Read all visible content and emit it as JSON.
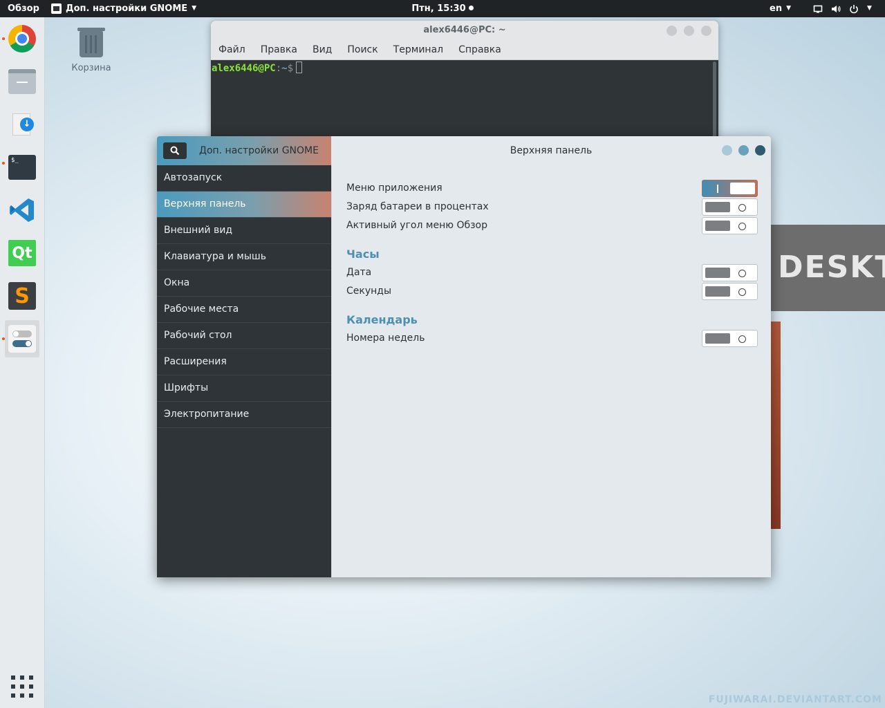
{
  "topbar": {
    "overview": "Обзор",
    "app_menu": "Доп. настройки GNOME",
    "clock": "Птн, 15:30",
    "lang": "en"
  },
  "desktop": {
    "trash_label": "Корзина",
    "wallpaper_text": "DESKT",
    "watermark": "FUJIWARAI.DEVIANTART.COM"
  },
  "dock": {
    "apps": [
      "chrome-icon",
      "files-icon",
      "downloader-icon",
      "terminal-icon",
      "vscode-icon",
      "qt-creator-icon",
      "sublime-text-icon",
      "gnome-tweaks-icon"
    ],
    "qt_label": "Qt",
    "sublime_label": "S",
    "term_label": "$_"
  },
  "terminal": {
    "title": "alex6446@PC: ~",
    "menu": [
      "Файл",
      "Правка",
      "Вид",
      "Поиск",
      "Терминал",
      "Справка"
    ],
    "prompt_user": "alex6446@PC",
    "prompt_sep": ":",
    "prompt_path": "~",
    "prompt_sym": "$"
  },
  "tweaks": {
    "app_title": "Доп. настройки GNOME",
    "page_title": "Верхняя панель",
    "sidebar": [
      {
        "label": "Автозапуск"
      },
      {
        "label": "Верхняя панель"
      },
      {
        "label": "Внешний вид"
      },
      {
        "label": "Клавиатура и мышь"
      },
      {
        "label": "Окна"
      },
      {
        "label": "Рабочие места"
      },
      {
        "label": "Рабочий стол"
      },
      {
        "label": "Расширения"
      },
      {
        "label": "Шрифты"
      },
      {
        "label": "Электропитание"
      }
    ],
    "selected_index": 1,
    "settings": {
      "app_menu": {
        "label": "Меню приложения",
        "on": true
      },
      "battery_percent": {
        "label": "Заряд батареи в процентах",
        "on": false
      },
      "hot_corner": {
        "label": "Активный угол меню Обзор",
        "on": false
      }
    },
    "clock_section": {
      "title": "Часы",
      "date": {
        "label": "Дата",
        "on": false
      },
      "seconds": {
        "label": "Секунды",
        "on": false
      }
    },
    "calendar_section": {
      "title": "Календарь",
      "week_numbers": {
        "label": "Номера недель",
        "on": false
      }
    }
  },
  "colors": {
    "accent_blue": "#4b9bbf",
    "accent_salmon": "#c8826f",
    "sidebar_bg": "#2e3437",
    "section_title": "#4f8faf"
  }
}
